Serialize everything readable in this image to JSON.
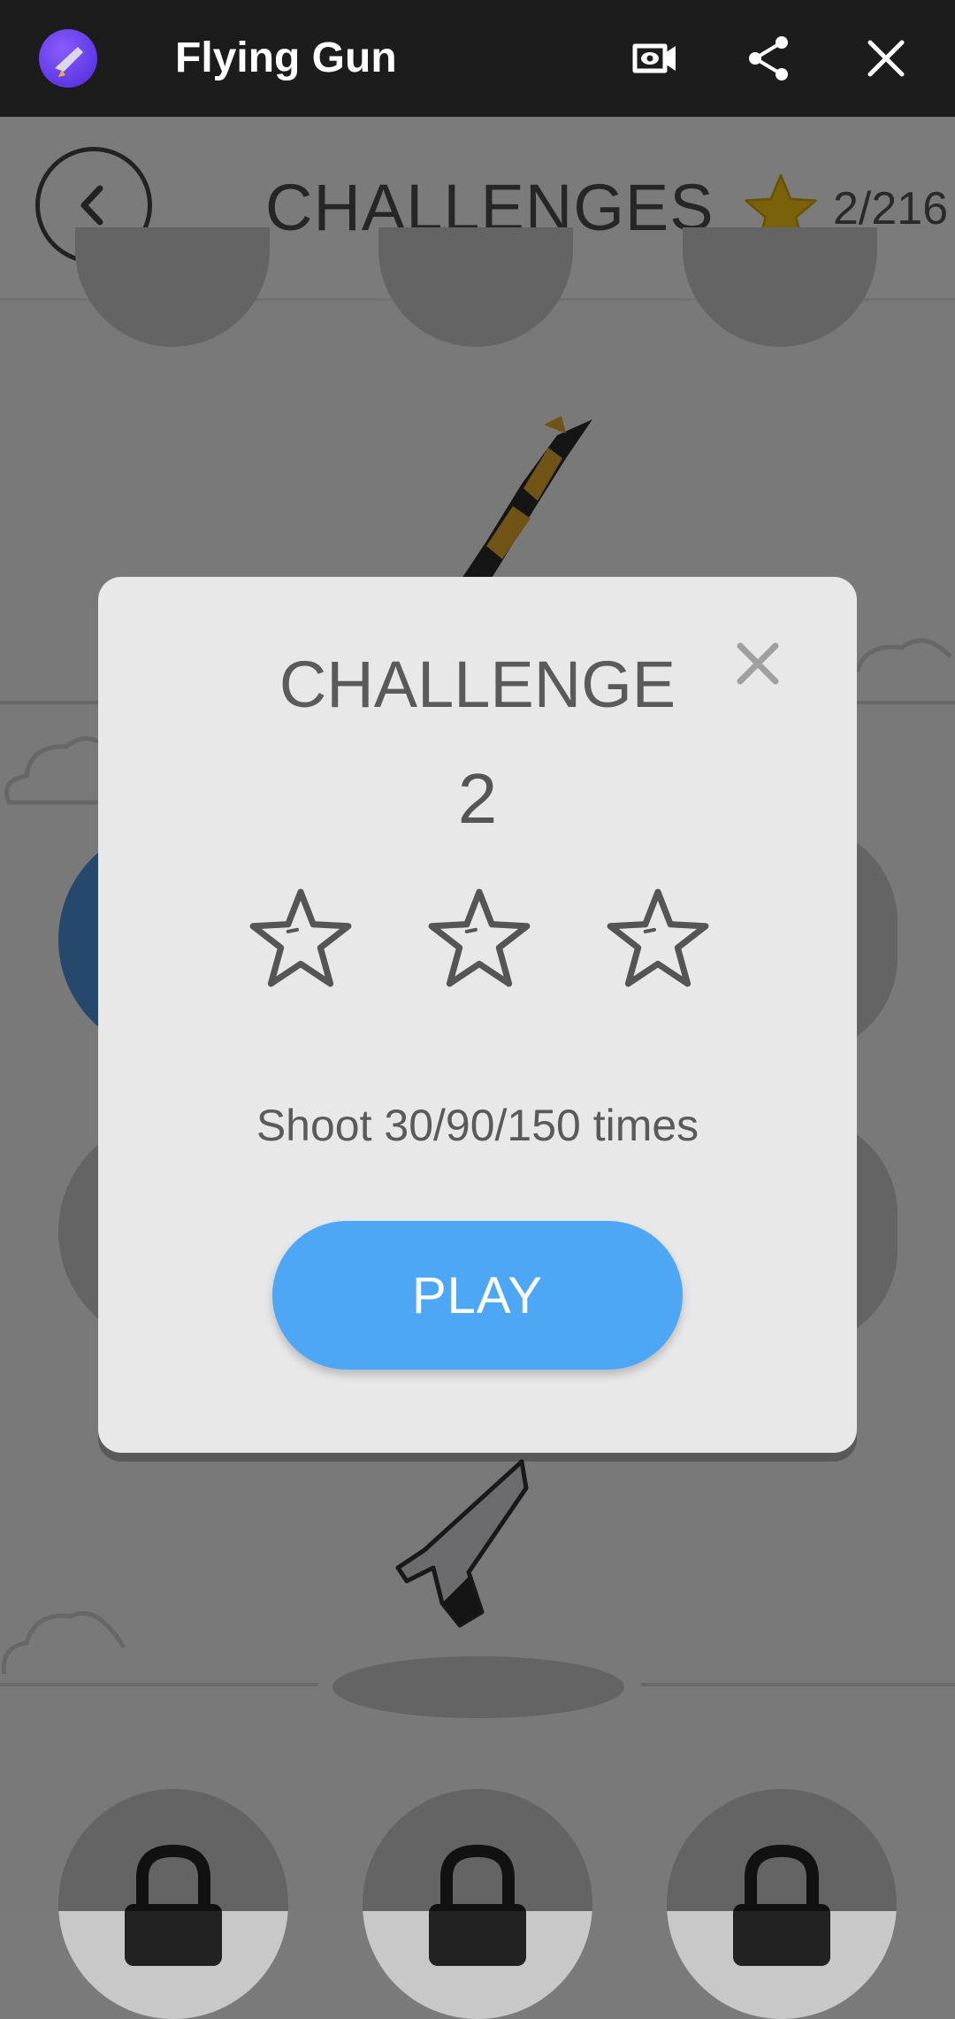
{
  "app_bar": {
    "title": "Flying Gun",
    "icons": [
      "app-icon",
      "video-icon",
      "share-icon",
      "close-icon"
    ]
  },
  "game": {
    "header": {
      "title": "CHALLENGES",
      "stars_collected": "2/216"
    },
    "icons": [
      "back-icon",
      "star-icon",
      "rifle-icon",
      "pistol-icon",
      "lock-icon",
      "cloud-icon"
    ]
  },
  "dialog": {
    "title": "CHALLENGE",
    "number": "2",
    "stars_earned": 0,
    "stars_total": 3,
    "description": "Shoot 30/90/150 times",
    "play_label": "PLAY"
  },
  "colors": {
    "app_bar": "#1c1c1c",
    "play_button": "#4da7f5",
    "dialog_bg": "#e8e8e8",
    "star_gold": "#f5c518"
  }
}
